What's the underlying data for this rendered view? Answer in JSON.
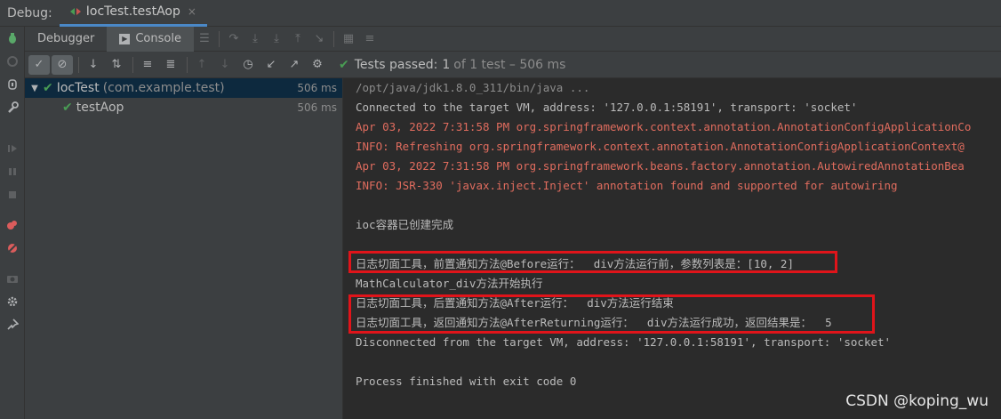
{
  "header": {
    "debug_label": "Debug:",
    "tab_title": "IocTest.testAop",
    "close_glyph": "×"
  },
  "subbar": {
    "debugger_label": "Debugger",
    "console_label": "Console"
  },
  "testbar": {
    "status_prefix": "Tests passed:",
    "status_count": "1",
    "status_suffix": "of 1 test – 506 ms"
  },
  "tree": {
    "items": [
      {
        "name": "IocTest",
        "pkg": "(com.example.test)",
        "time": "506 ms"
      },
      {
        "name": "testAop",
        "pkg": "",
        "time": "506 ms"
      }
    ]
  },
  "console": {
    "lines": [
      {
        "text": "/opt/java/jdk1.8.0_311/bin/java ...",
        "kind": "path"
      },
      {
        "text": "Connected to the target VM, address: '127.0.0.1:58191', transport: 'socket'",
        "kind": "gray"
      },
      {
        "text": "Apr 03, 2022 7:31:58 PM org.springframework.context.annotation.AnnotationConfigApplicationCo",
        "kind": "red"
      },
      {
        "text": "INFO: Refreshing org.springframework.context.annotation.AnnotationConfigApplicationContext@",
        "kind": "red"
      },
      {
        "text": "Apr 03, 2022 7:31:58 PM org.springframework.beans.factory.annotation.AutowiredAnnotationBea",
        "kind": "red"
      },
      {
        "text": "INFO: JSR-330 'javax.inject.Inject' annotation found and supported for autowiring",
        "kind": "red"
      },
      {
        "text": "",
        "kind": "gray"
      },
      {
        "text": "ioc容器已创建完成",
        "kind": "gray"
      },
      {
        "text": "",
        "kind": "gray"
      },
      {
        "text": "日志切面工具，前置通知方法@Before运行：  div方法运行前，参数列表是：[10, 2]",
        "kind": "gray"
      },
      {
        "text": "MathCalculator_div方法开始执行",
        "kind": "gray"
      },
      {
        "text": "日志切面工具，后置通知方法@After运行：  div方法运行结束",
        "kind": "gray"
      },
      {
        "text": "日志切面工具，返回通知方法@AfterReturning运行：  div方法运行成功，返回结果是：  5",
        "kind": "gray"
      },
      {
        "text": "Disconnected from the target VM, address: '127.0.0.1:58191', transport: 'socket'",
        "kind": "gray"
      },
      {
        "text": "",
        "kind": "gray"
      },
      {
        "text": "Process finished with exit code 0",
        "kind": "gray"
      }
    ]
  },
  "watermark": "CSDN @koping_wu",
  "colors": {
    "accent": "#4a88c7",
    "pass": "#499c54",
    "error": "#e06c5e",
    "highlight": "#e0141a"
  }
}
